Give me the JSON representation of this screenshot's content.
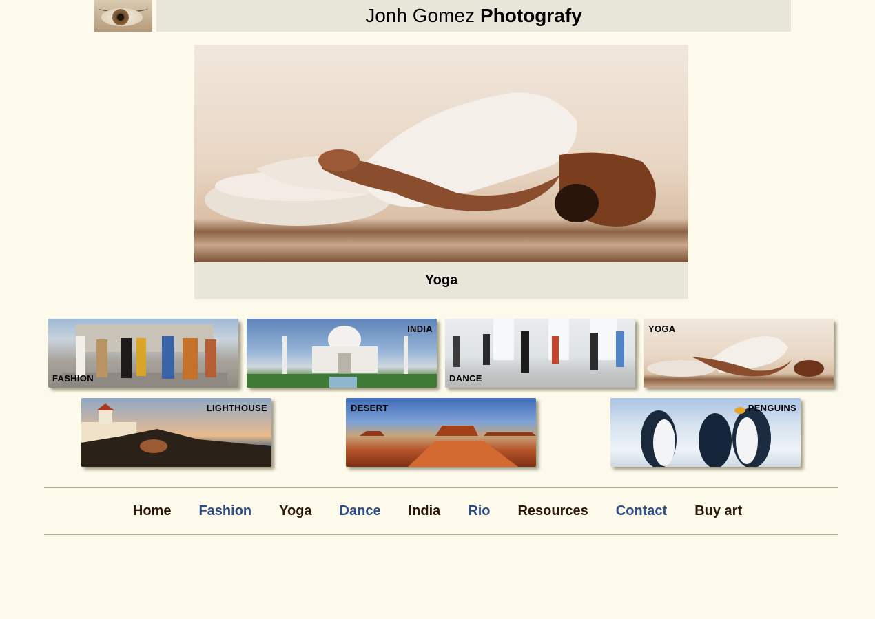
{
  "header": {
    "logo_icon": "eye-icon",
    "title_regular": "Jonh Gomez",
    "title_bold": "Photografy"
  },
  "featured": {
    "caption": "Yoga"
  },
  "gallery": {
    "row1": [
      {
        "label": "FASHION"
      },
      {
        "label": "INDIA"
      },
      {
        "label": "DANCE"
      },
      {
        "label": "YOGA"
      }
    ],
    "row2": [
      {
        "label": "LIGHTHOUSE"
      },
      {
        "label": "DESERT"
      },
      {
        "label": "PENGUINS"
      }
    ]
  },
  "nav": {
    "items": [
      {
        "label": "Home",
        "color": "#2a1705"
      },
      {
        "label": "Fashion",
        "color": "#2e4d86"
      },
      {
        "label": "Yoga",
        "color": "#2a1705"
      },
      {
        "label": "Dance",
        "color": "#2e4d86"
      },
      {
        "label": "India",
        "color": "#2a1705"
      },
      {
        "label": "Rio",
        "color": "#2e4d86"
      },
      {
        "label": "Resources",
        "color": "#2a1705"
      },
      {
        "label": "Contact",
        "color": "#2e4d86"
      },
      {
        "label": "Buy art",
        "color": "#2a1705"
      }
    ]
  },
  "colors": {
    "background": "#fdfaec",
    "bar": "#e8e5d9",
    "rule": "#b4a989"
  }
}
